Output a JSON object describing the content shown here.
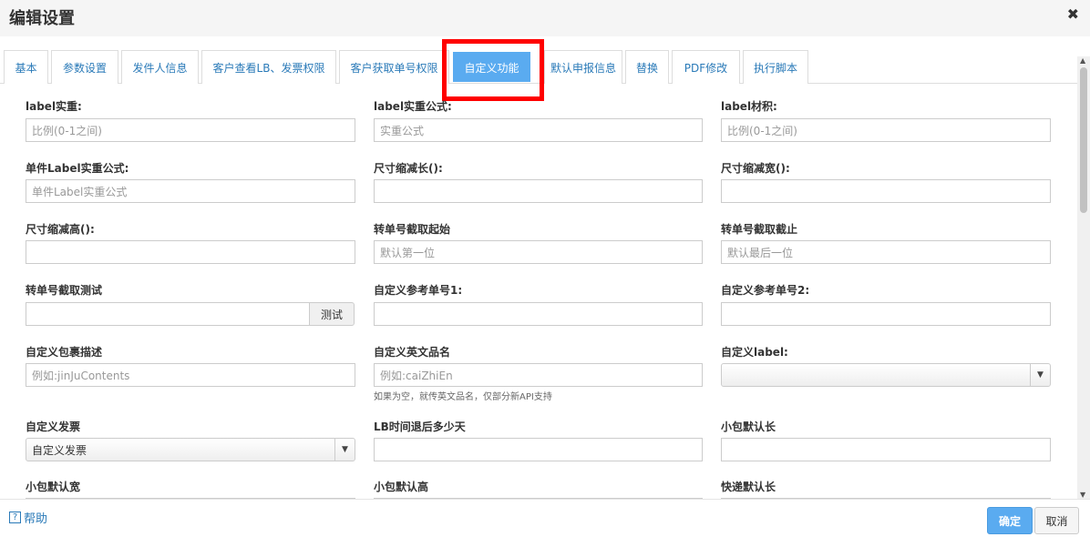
{
  "dialog": {
    "title": "编辑设置"
  },
  "tabs": [
    "基本",
    "参数设置",
    "发件人信息",
    "客户查看LB、发票权限",
    "客户获取单号权限",
    "自定义功能",
    "默认申报信息",
    "替换",
    "PDF修改",
    "执行脚本"
  ],
  "active_tab": "自定义功能",
  "fields": {
    "label_weight": {
      "label": "label实重:",
      "placeholder": "比例(0-1之间)"
    },
    "label_weight_formula": {
      "label": "label实重公式:",
      "placeholder": "实重公式"
    },
    "label_volume": {
      "label": "label材积:",
      "placeholder": "比例(0-1之间)"
    },
    "single_label_formula": {
      "label": "单件Label实重公式:",
      "placeholder": "单件Label实重公式"
    },
    "shrink_length": {
      "label": "尺寸缩减长():",
      "placeholder": ""
    },
    "shrink_width": {
      "label": "尺寸缩减宽():",
      "placeholder": ""
    },
    "shrink_height": {
      "label": "尺寸缩减高():",
      "placeholder": ""
    },
    "cut_start": {
      "label": "转单号截取起始",
      "placeholder": "默认第一位"
    },
    "cut_end": {
      "label": "转单号截取截止",
      "placeholder": "默认最后一位"
    },
    "cut_test": {
      "label": "转单号截取测试",
      "placeholder": "",
      "button": "测试"
    },
    "ref_no_1": {
      "label": "自定义参考单号1:",
      "placeholder": ""
    },
    "ref_no_2": {
      "label": "自定义参考单号2:",
      "placeholder": ""
    },
    "package_desc": {
      "label": "自定义包裹描述",
      "placeholder": "例如:jinJuContents"
    },
    "english_name": {
      "label": "自定义英文品名",
      "placeholder": "例如:caiZhiEn",
      "hint": "如果为空，就传英文品名，仅部分新API支持"
    },
    "custom_label": {
      "label": "自定义label:",
      "value": ""
    },
    "custom_invoice": {
      "label": "自定义发票",
      "value": "自定义发票"
    },
    "lb_delay_days": {
      "label": "LB时间退后多少天",
      "placeholder": ""
    },
    "small_pkg_length": {
      "label": "小包默认长",
      "placeholder": ""
    },
    "small_pkg_width": {
      "label": "小包默认宽"
    },
    "small_pkg_height": {
      "label": "小包默认高"
    },
    "express_length": {
      "label": "快递默认长"
    }
  },
  "footer": {
    "help": "帮助",
    "help_icon": "?",
    "ok": "确定",
    "cancel": "取消"
  },
  "icons": {
    "close": "close-icon",
    "dropdown": "chevron-down-icon",
    "help": "help-icon"
  },
  "colors": {
    "accent": "#5aabf0",
    "link": "#2a7ab8",
    "highlight": "#ff0000"
  }
}
